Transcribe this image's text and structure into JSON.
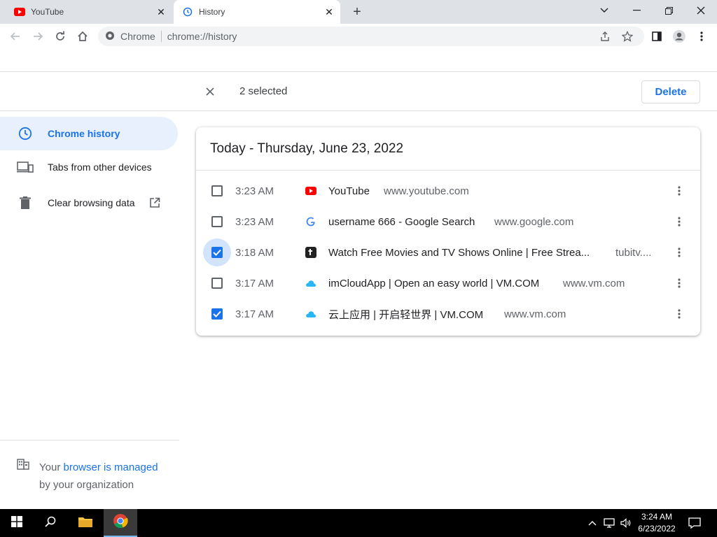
{
  "browser": {
    "tabs": [
      {
        "title": "YouTube",
        "icon": "youtube-icon",
        "active": false
      },
      {
        "title": "History",
        "icon": "history-icon",
        "active": true
      }
    ],
    "address": {
      "chip_label": "Chrome",
      "url": "chrome://history"
    }
  },
  "selection": {
    "count_text": "2 selected",
    "delete_label": "Delete"
  },
  "sidebar": {
    "items": [
      {
        "label": "Chrome history",
        "icon": "clock-icon",
        "active": true
      },
      {
        "label": "Tabs from other devices",
        "icon": "devices-icon",
        "active": false
      },
      {
        "label": "Clear browsing data",
        "icon": "trash-icon",
        "active": false
      }
    ],
    "managed": {
      "prefix": "Your ",
      "link": "browser is managed",
      "suffix": "by your organization"
    }
  },
  "history": {
    "date_header": "Today - Thursday, June 23, 2022",
    "entries": [
      {
        "time": "3:23 AM",
        "title": "YouTube",
        "domain": "www.youtube.com",
        "icon": "youtube-icon",
        "checked": false
      },
      {
        "time": "3:23 AM",
        "title": "username 666 - Google Search",
        "domain": "www.google.com",
        "icon": "google-icon",
        "checked": false
      },
      {
        "time": "3:18 AM",
        "title": "Watch Free Movies and TV Shows Online | Free Strea...",
        "domain": "tubitv....",
        "icon": "tubi-icon",
        "checked": true
      },
      {
        "time": "3:17 AM",
        "title": "imCloudApp | Open an easy world | VM.COM",
        "domain": "www.vm.com",
        "icon": "cloud-icon",
        "checked": false
      },
      {
        "time": "3:17 AM",
        "title": "云上应用 | 开启轻世界 | VM.COM",
        "domain": "www.vm.com",
        "icon": "cloud-icon",
        "checked": true
      }
    ]
  },
  "taskbar": {
    "time": "3:24 AM",
    "date": "6/23/2022"
  },
  "colors": {
    "accent": "#1a73e8",
    "youtube_red": "#ff0000",
    "sidebar_active_bg": "#e8f0fe"
  }
}
